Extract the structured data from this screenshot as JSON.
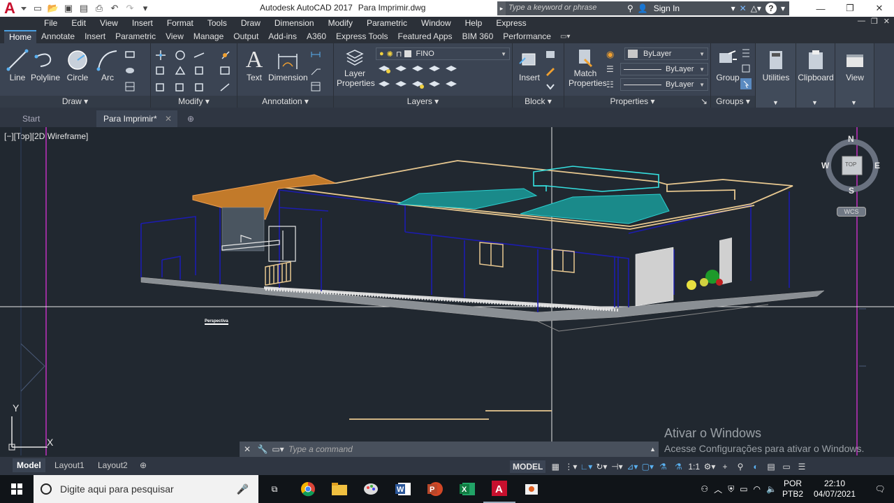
{
  "app": {
    "title": "Autodesk AutoCAD 2017",
    "document": "Para Imprimir.dwg"
  },
  "search": {
    "placeholder": "Type a keyword or phrase"
  },
  "account": {
    "signin": "Sign In"
  },
  "menu": [
    "File",
    "Edit",
    "View",
    "Insert",
    "Format",
    "Tools",
    "Draw",
    "Dimension",
    "Modify",
    "Parametric",
    "Window",
    "Help",
    "Express"
  ],
  "ribbon_tabs": [
    "Home",
    "Annotate",
    "Insert",
    "Parametric",
    "View",
    "Manage",
    "Output",
    "Add-ins",
    "A360",
    "Express Tools",
    "Featured Apps",
    "BIM 360",
    "Performance"
  ],
  "ribbon_active_tab": "Home",
  "draw": {
    "title": "Draw",
    "line": "Line",
    "polyline": "Polyline",
    "circle": "Circle",
    "arc": "Arc"
  },
  "modify": {
    "title": "Modify"
  },
  "annotation": {
    "title": "Annotation",
    "text": "Text",
    "dimension": "Dimension"
  },
  "layers": {
    "title": "Layers",
    "layer_properties_1": "Layer",
    "layer_properties_2": "Properties",
    "current_layer": "FINO"
  },
  "block": {
    "title": "Block",
    "insert": "Insert"
  },
  "properties": {
    "title": "Properties",
    "match_1": "Match",
    "match_2": "Properties",
    "color": "ByLayer",
    "linetype": "ByLayer",
    "lineweight": "ByLayer"
  },
  "groups": {
    "title": "Groups",
    "group": "Group"
  },
  "utilities": {
    "label": "Utilities"
  },
  "clipboard": {
    "label": "Clipboard"
  },
  "view": {
    "label": "View"
  },
  "doc_tabs": {
    "start": "Start",
    "active": "Para Imprimir*"
  },
  "viewport": {
    "label": "[−][Top][2D Wireframe]",
    "annotation": "Perspectiva"
  },
  "viewcube": {
    "n": "N",
    "s": "S",
    "e": "E",
    "w": "W",
    "top": "TOP",
    "wcs": "WCS"
  },
  "ucs": {
    "x": "X",
    "y": "Y"
  },
  "command": {
    "placeholder": "Type a command"
  },
  "watermark": {
    "line1": "Ativar o Windows",
    "line2": "Acesse Configurações para ativar o Windows."
  },
  "layouts": {
    "model": "Model",
    "layout1": "Layout1",
    "layout2": "Layout2"
  },
  "status": {
    "model": "MODEL",
    "scale": "1:1"
  },
  "taskbar": {
    "search": "Digite aqui para pesquisar",
    "lang1": "POR",
    "lang2": "PTB2",
    "time": "22:10",
    "date": "04/07/2021"
  },
  "colors": {
    "accent": "#4a9fe0",
    "ribbon": "#3b4453",
    "viewport": "#212830",
    "walls": "#1a1aa8",
    "roof": "#e8c890",
    "pool": "#1fb5b5",
    "tile": "#c27a2a"
  }
}
